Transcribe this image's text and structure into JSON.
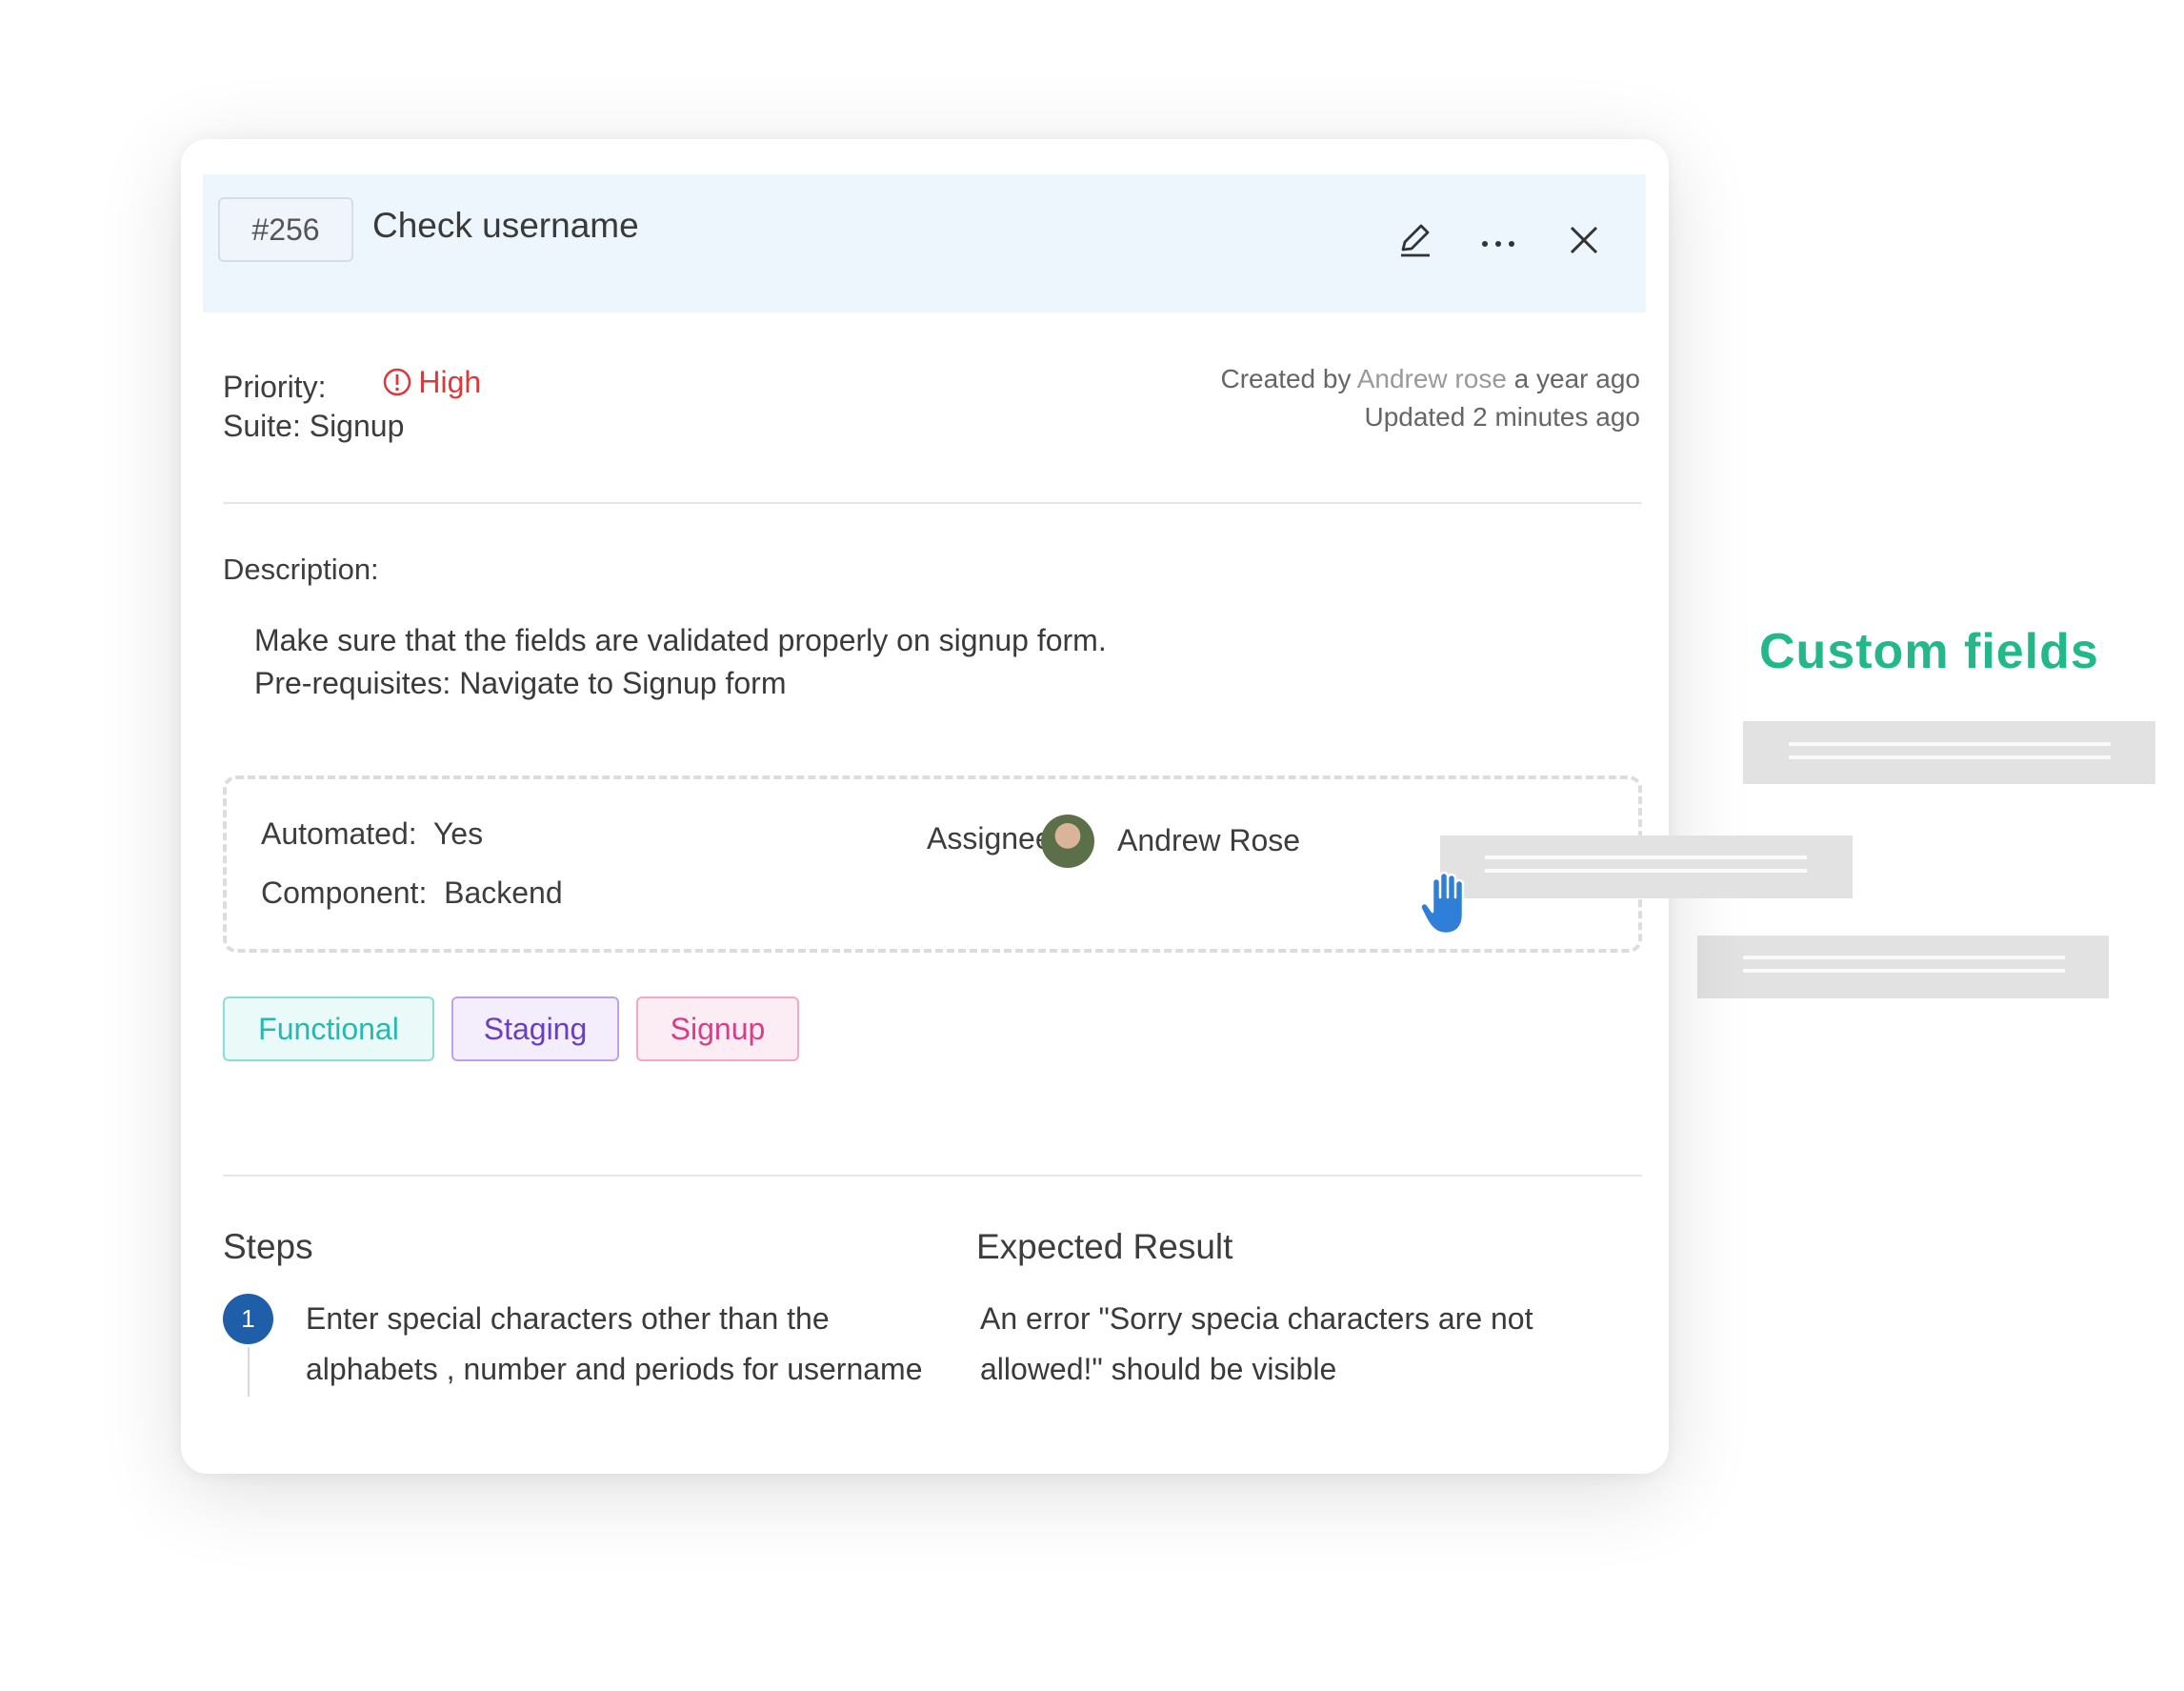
{
  "ticket": {
    "id": "#256",
    "title": "Check username"
  },
  "header_icons": [
    "pencil-icon",
    "more-icon",
    "close-icon"
  ],
  "meta": {
    "priority_label": "Priority:",
    "priority_value": "High",
    "suite_label": "Suite: Signup",
    "created_prefix": "Created by",
    "created_author": "Andrew rose",
    "created_suffix": "a year ago",
    "updated": "Updated 2 minutes ago"
  },
  "description": {
    "label": "Description:",
    "line1": "Make sure that the fields are validated properly on signup form.",
    "line2": "Pre-requisites: Navigate to Signup form"
  },
  "custom_fields": {
    "automated_label": "Automated:",
    "automated_value": "Yes",
    "component_label": "Component:",
    "component_value": "Backend",
    "assignee_label": "Assignee:",
    "assignee_value": "Andrew Rose"
  },
  "tags": [
    "Functional",
    "Staging",
    "Signup"
  ],
  "steps": {
    "steps_title": "Steps",
    "expected_title": "Expected Result",
    "items": [
      {
        "number": "1",
        "step": "Enter special characters other than the alphabets , number and periods for username",
        "expected": "An error \"Sorry specia characters are not allowed!\" should be visible"
      }
    ]
  },
  "side_callout": {
    "heading": "Custom fields"
  },
  "colors": {
    "header_bg": "#edf5fd",
    "priority_high": "#d93b3b",
    "callout_green": "#22b88a",
    "step_badge": "#1f5ea8"
  }
}
